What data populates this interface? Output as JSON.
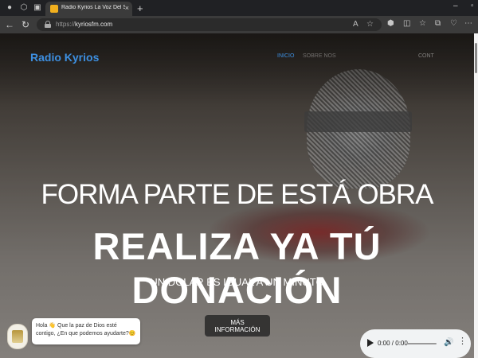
{
  "browser": {
    "tab_title": "Radio Kyrios La Voz Del Señor",
    "tab_close_glyph": "×",
    "new_tab_glyph": "+",
    "url_scheme": "https://",
    "url_host": "kyriosfm.com",
    "controls": {
      "minimize": "–",
      "maximize": "▫",
      "back": "←",
      "reload": "↻"
    },
    "icons": [
      "profile-icon",
      "workspaces-icon",
      "tab-actions-icon",
      "info-icon",
      "read-aloud-icon",
      "favorite-icon",
      "extensions-icon",
      "split-screen-icon",
      "favorites-icon",
      "collections-icon",
      "settings-icon",
      "browser-essentials-icon"
    ]
  },
  "site": {
    "brand": "Radio Kyrios",
    "nav": [
      {
        "label": "INICIO",
        "active": true
      },
      {
        "label": "SOBRE NOS",
        "active": false
      },
      {
        "label": "CONT",
        "active": false
      }
    ]
  },
  "hero": {
    "line1": "FORMA PARTE DE ESTÁ OBRA",
    "line2": "REALIZA YA TÚ DONACIÓN",
    "line3": "UN DOLAR ES IGUAL A UN MINUTO",
    "button": "MÁS INFORMACIÓN"
  },
  "chat": {
    "message": "Hola 👋 Que la paz de Dios esté contigo, ¿En que podemos ayudarte?😊"
  },
  "audio_player": {
    "time": "0:00 / 0:00",
    "volume_glyph": "🔊",
    "menu_glyph": "⋮"
  },
  "colors": {
    "brand": "#3d8fe0",
    "chrome_bg": "#202124",
    "toolbar_bg": "#3b3b3b"
  }
}
